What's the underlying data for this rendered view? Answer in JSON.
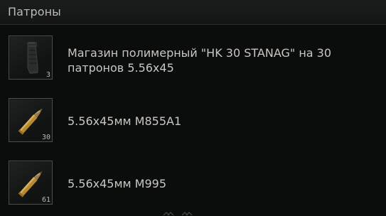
{
  "header": {
    "title": "Патроны"
  },
  "items": [
    {
      "name": "Магазин полимерный \"HK 30 STANAG\" на 30 патронов 5.56x45",
      "count": "3",
      "icon": "magazine-icon"
    },
    {
      "name": "5.56x45мм M855A1",
      "count": "30",
      "icon": "cartridge-icon"
    },
    {
      "name": "5.56x45мм M995",
      "count": "61",
      "icon": "cartridge-icon"
    }
  ],
  "colors": {
    "background": "#0b0c0c",
    "header": "#1b1d1d",
    "slot_border": "#4b4d4b",
    "text": "#c8c8c2"
  }
}
